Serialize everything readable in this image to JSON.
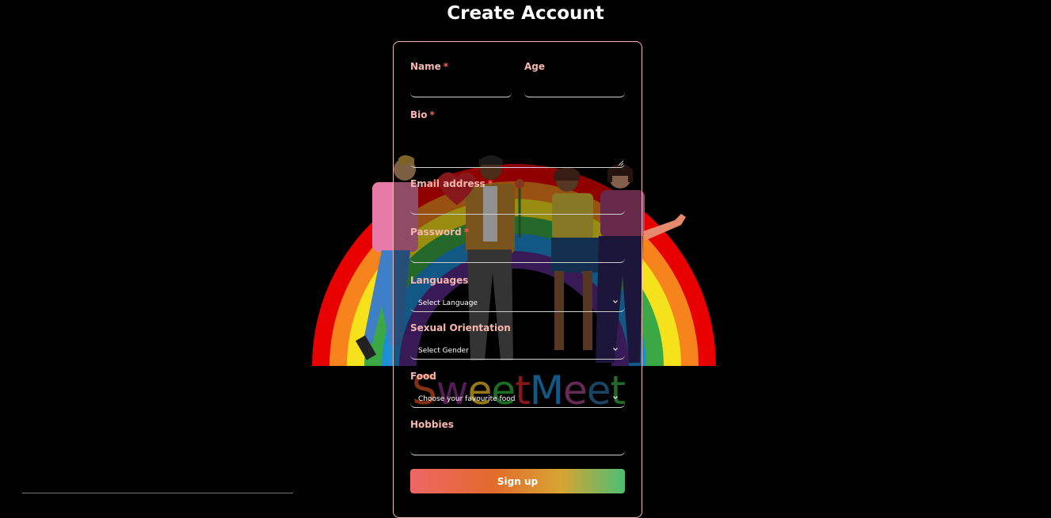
{
  "page": {
    "title": "Create Account"
  },
  "brand": {
    "letters": [
      "S",
      "w",
      "e",
      "e",
      "t",
      "M",
      "e",
      "e",
      "t"
    ]
  },
  "form": {
    "name": {
      "label": "Name",
      "required": "*"
    },
    "age": {
      "label": "Age"
    },
    "bio": {
      "label": "Bio",
      "required": "*"
    },
    "email": {
      "label": "Email address",
      "required": "*"
    },
    "password": {
      "label": "Password",
      "required": "*"
    },
    "languages": {
      "label": "Languages",
      "selected": "Select Language"
    },
    "orientation": {
      "label": "Sexual Orientation",
      "selected": "Select Gender"
    },
    "food": {
      "label": "Food",
      "selected": "Choose your favourite food"
    },
    "hobbies": {
      "label": "Hobbies"
    },
    "submit_label": "Sign up"
  },
  "colors": {
    "accent_label": "#f7b6ae",
    "required": "#ff5e55",
    "button_gradient": [
      "#ee6767",
      "#e26a2c",
      "#d8a433",
      "#4cbe73"
    ]
  }
}
